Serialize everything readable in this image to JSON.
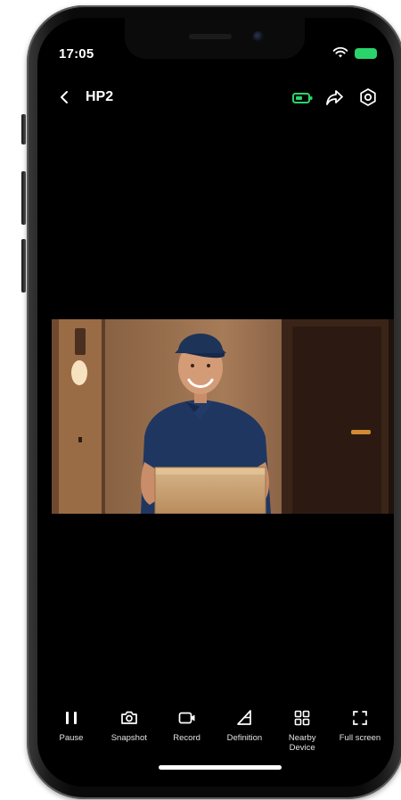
{
  "status_bar": {
    "time": "17:05"
  },
  "header": {
    "back_label": "<",
    "title": "HP2"
  },
  "header_icons": [
    "battery-icon",
    "share-icon",
    "settings-icon"
  ],
  "video": {
    "subject": "delivery person holding a cardboard box at the door"
  },
  "controls": [
    {
      "id": "pause",
      "label": "Pause",
      "icon": "pause-icon"
    },
    {
      "id": "snapshot",
      "label": "Snapshot",
      "icon": "camera-icon"
    },
    {
      "id": "record",
      "label": "Record",
      "icon": "video-record-icon"
    },
    {
      "id": "definition",
      "label": "Definition",
      "icon": "definition-icon"
    },
    {
      "id": "nearby",
      "label": "Nearby\nDevice",
      "icon": "grid-icon"
    },
    {
      "id": "fullscreen",
      "label": "Full screen",
      "icon": "fullscreen-icon"
    }
  ],
  "colors": {
    "accent_green": "#2bd46b",
    "background": "#000000",
    "text": "#ffffff"
  }
}
